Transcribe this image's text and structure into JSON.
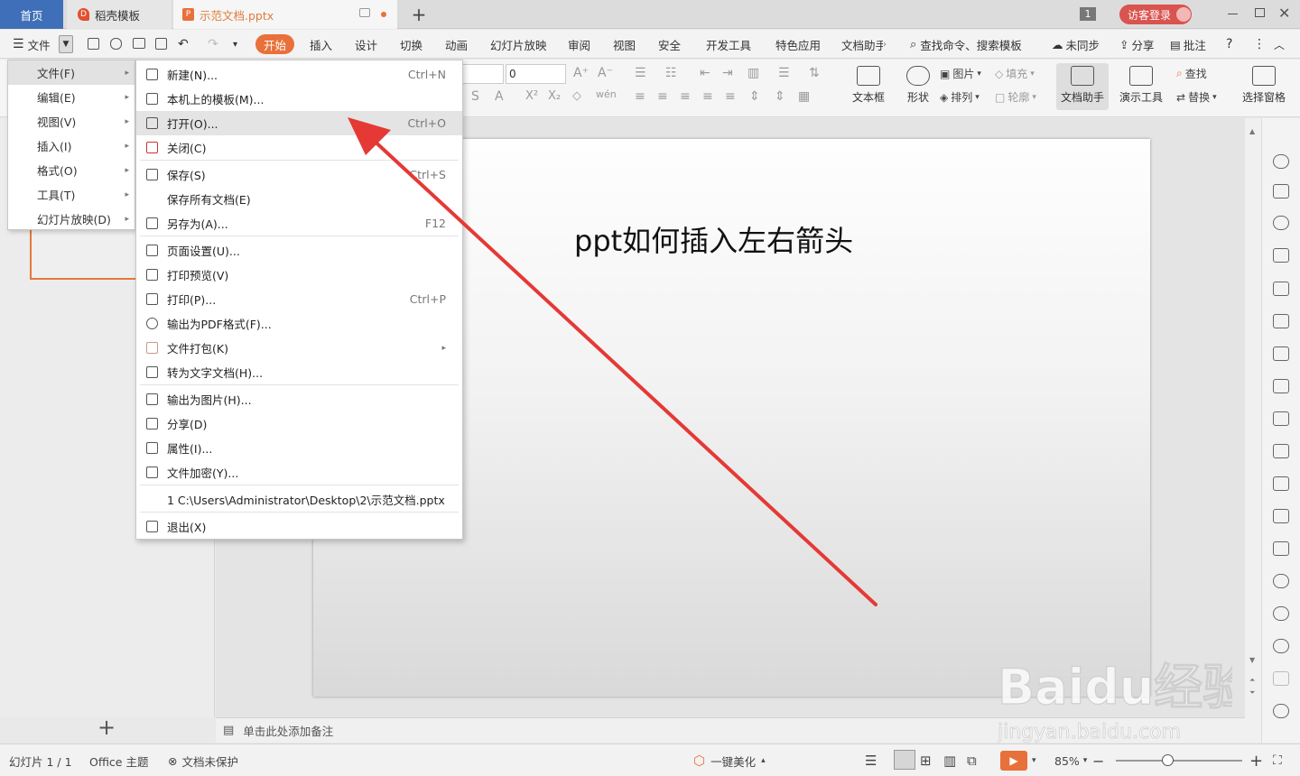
{
  "tabs": {
    "home": "首页",
    "template": "稻壳模板",
    "document": "示范文档.pptx",
    "new_tab": "+"
  },
  "titlebar": {
    "window_count": "1",
    "login": "访客登录"
  },
  "menubar": {
    "file": "文件",
    "items": [
      "开始",
      "插入",
      "设计",
      "切换",
      "动画",
      "幻灯片放映",
      "审阅",
      "视图",
      "安全",
      "开发工具",
      "特色应用",
      "文档助手"
    ],
    "search": "查找命令、搜索模板",
    "not_synced": "未同步",
    "share": "分享",
    "comment": "批注",
    "help": "?",
    "more": "⋮"
  },
  "ribbon": {
    "font_size": "0",
    "textbox": "文本框",
    "shape": "形状",
    "picture": "图片",
    "arrange": "排列",
    "fill": "填充",
    "outline": "轮廓",
    "doc_assistant": "文档助手",
    "presenter_tools": "演示工具",
    "find": "查找",
    "replace": "替换",
    "selection_pane": "选择窗格"
  },
  "file_menu": {
    "items": [
      "文件(F)",
      "编辑(E)",
      "视图(V)",
      "插入(I)",
      "格式(O)",
      "工具(T)",
      "幻灯片放映(D)"
    ]
  },
  "submenu": {
    "new": {
      "label": "新建(N)...",
      "shortcut": "Ctrl+N"
    },
    "local_template": {
      "label": "本机上的模板(M)..."
    },
    "open": {
      "label": "打开(O)...",
      "shortcut": "Ctrl+O"
    },
    "close": {
      "label": "关闭(C)"
    },
    "save": {
      "label": "保存(S)",
      "shortcut": "Ctrl+S"
    },
    "save_all": {
      "label": "保存所有文档(E)"
    },
    "save_as": {
      "label": "另存为(A)...",
      "shortcut": "F12"
    },
    "page_setup": {
      "label": "页面设置(U)..."
    },
    "print_preview": {
      "label": "打印预览(V)"
    },
    "print": {
      "label": "打印(P)...",
      "shortcut": "Ctrl+P"
    },
    "export_pdf": {
      "label": "输出为PDF格式(F)..."
    },
    "pack": {
      "label": "文件打包(K)"
    },
    "to_text": {
      "label": "转为文字文档(H)..."
    },
    "export_image": {
      "label": "输出为图片(H)..."
    },
    "share": {
      "label": "分享(D)"
    },
    "properties": {
      "label": "属性(I)..."
    },
    "encrypt": {
      "label": "文件加密(Y)..."
    },
    "recent": {
      "label": "1 C:\\Users\\Administrator\\Desktop\\2\\示范文档.pptx"
    },
    "exit": {
      "label": "退出(X)"
    }
  },
  "slide": {
    "title": "ppt如何插入左右箭头"
  },
  "notes": {
    "placeholder": "单击此处添加备注"
  },
  "statusbar": {
    "slide_count": "幻灯片 1 / 1",
    "theme": "Office 主题",
    "protection": "文档未保护",
    "beautify": "一键美化",
    "zoom": "85%"
  },
  "watermark": {
    "brand": "Baidu经验",
    "url": "jingyan.baidu.com"
  },
  "colors": {
    "accent": "#e8703a",
    "home_tab": "#3f6fb8",
    "arrow": "#e53935"
  }
}
